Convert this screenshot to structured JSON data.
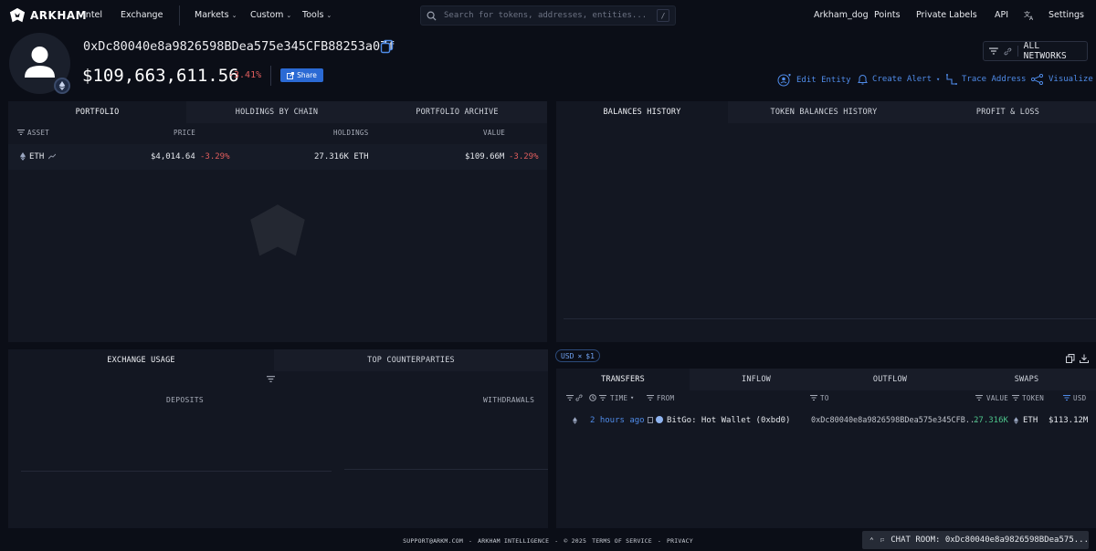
{
  "brand": {
    "name": "ARKHAM"
  },
  "nav": {
    "intel": "Intel",
    "exchange": "Exchange",
    "markets": "Markets",
    "custom": "Custom",
    "tools": "Tools"
  },
  "search": {
    "placeholder": "Search for tokens, addresses, entities...",
    "shortcut": "/"
  },
  "user_nav": {
    "username": "Arkham_dog",
    "points": "Points",
    "private_labels": "Private Labels",
    "api": "API",
    "settings": "Settings"
  },
  "profile": {
    "address": "0xDc80040e8a9826598BDea575e345CFB88253a07f",
    "balance": "$109,663,611.56",
    "change": "-3.41%",
    "share": "Share"
  },
  "networks": {
    "label": "ALL NETWORKS"
  },
  "actions": {
    "edit_entity": "Edit Entity",
    "create_alert": "Create Alert",
    "trace_address": "Trace Address",
    "visualize": "Visualize"
  },
  "portfolio": {
    "tabs": [
      "PORTFOLIO",
      "HOLDINGS BY CHAIN",
      "PORTFOLIO ARCHIVE"
    ],
    "columns": {
      "asset": "ASSET",
      "price": "PRICE",
      "holdings": "HOLDINGS",
      "value": "VALUE"
    },
    "rows": [
      {
        "asset": "ETH",
        "price": "$4,014.64",
        "price_change": "-3.29%",
        "holdings": "27.316K ETH",
        "value": "$109.66M",
        "value_change": "-3.29%"
      }
    ]
  },
  "balances": {
    "tabs": [
      "BALANCES HISTORY",
      "TOKEN BALANCES HISTORY",
      "PROFIT & LOSS"
    ]
  },
  "exchange": {
    "tabs": [
      "EXCHANGE USAGE",
      "TOP COUNTERPARTIES"
    ],
    "deposits": "DEPOSITS",
    "withdrawals": "WITHDRAWALS"
  },
  "transfers": {
    "currency_chip": "USD",
    "min_chip": "$1",
    "tabs": [
      "TRANSFERS",
      "INFLOW",
      "OUTFLOW",
      "SWAPS"
    ],
    "columns": {
      "time": "TIME",
      "from": "FROM",
      "to": "TO",
      "value": "VALUE",
      "token": "TOKEN",
      "usd": "USD"
    },
    "rows": [
      {
        "time": "2 hours ago",
        "from": "BitGo: Hot Wallet (0xbd0)",
        "to": "0xDc80040e8a9826598BDea575e345CFB...",
        "value": "27.316K",
        "token": "ETH",
        "usd": "$113.12M"
      }
    ]
  },
  "footer": {
    "support": "SUPPORT@ARKM.COM",
    "company": "ARKHAM INTELLIGENCE",
    "copyright": "© 2025",
    "terms": "TERMS OF SERVICE",
    "privacy": "PRIVACY",
    "sep": "-"
  },
  "chat": {
    "label": "CHAT ROOM: 0xDc80040e8a9826598BDea575..."
  },
  "colors": {
    "accent": "#2b6ad4",
    "negative": "#e05d5d",
    "positive": "#4cc38a",
    "link": "#4f8be8"
  }
}
